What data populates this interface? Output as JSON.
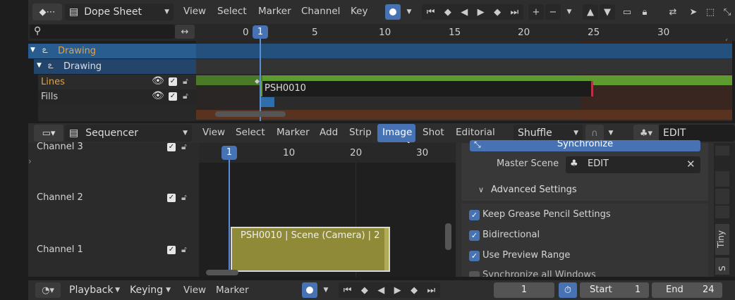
{
  "dopesheet": {
    "editor": "Dope Sheet",
    "menus": [
      "View",
      "Select",
      "Marker",
      "Channel",
      "Key"
    ],
    "current_frame": "1",
    "ruler": [
      "0",
      "5",
      "10",
      "15",
      "20",
      "25",
      "30"
    ],
    "channels": {
      "object": "Drawing",
      "data": "Drawing",
      "layer1": "Lines",
      "layer2": "Fills"
    },
    "strip_label": "PSH0010"
  },
  "sequencer": {
    "editor": "Sequencer",
    "menus": [
      "View",
      "Select",
      "Marker",
      "Add",
      "Strip",
      "Image",
      "Shot",
      "Editorial"
    ],
    "active_menu": "Image",
    "shuffle": "Shuffle",
    "scene": "EDIT",
    "current_frame": "1",
    "ruler": [
      "10",
      "20",
      "30"
    ],
    "channels": [
      "Channel 3",
      "Channel 2",
      "Channel 1"
    ],
    "strip_label": "PSH0010 | Scene (Camera) | 2",
    "panel": {
      "sync_button": "Synchronize",
      "master_scene_label": "Master Scene",
      "master_scene_value": "EDIT",
      "advanced_settings": "Advanced Settings",
      "opt1": "Keep Grease Pencil Settings",
      "opt2": "Bidirectional",
      "opt3": "Use Preview Range",
      "opt4": "Synchronize all Windows"
    },
    "side_tabs": [
      "Tiny",
      "S"
    ]
  },
  "timeline": {
    "playback": "Playback",
    "keying": "Keying",
    "view": "View",
    "marker": "Marker",
    "current": "1",
    "start_label": "Start",
    "start": "1",
    "end_label": "End",
    "end": "24"
  },
  "colors": {
    "accent": "#4772b3",
    "strip": "#8e8a37",
    "layer_orange": "#e8a23b",
    "green_bar": "#5d9a2f"
  }
}
